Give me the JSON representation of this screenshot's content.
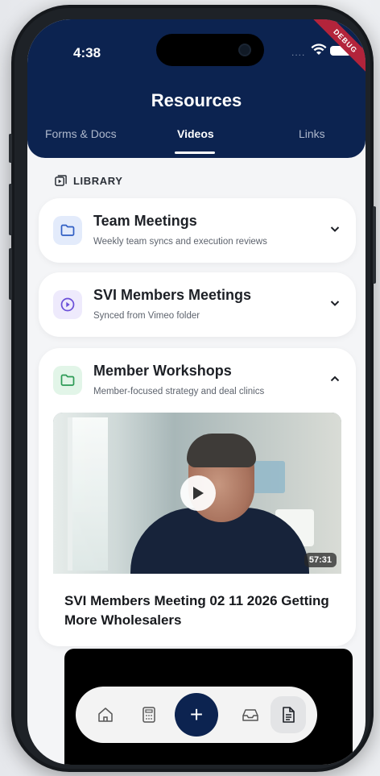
{
  "status_bar": {
    "time": "4:38",
    "signal": "....",
    "debug_banner": "DEBUG"
  },
  "header": {
    "title": "Resources",
    "tabs": [
      {
        "label": "Forms & Docs",
        "active": false
      },
      {
        "label": "Videos",
        "active": true
      },
      {
        "label": "Links",
        "active": false
      }
    ]
  },
  "library": {
    "label": "LIBRARY",
    "folders": [
      {
        "title": "Team Meetings",
        "subtitle": "Weekly team syncs and execution reviews",
        "icon": "folder-icon",
        "expanded": false
      },
      {
        "title": "SVI Members Meetings",
        "subtitle": "Synced from Vimeo folder",
        "icon": "play-circle-icon",
        "expanded": false
      },
      {
        "title": "Member Workshops",
        "subtitle": "Member-focused strategy and deal clinics",
        "icon": "folder-icon",
        "expanded": true
      }
    ],
    "videos": [
      {
        "title": "SVI Members Meeting 02 11 2026 Getting More Wholesalers",
        "duration": "57:31"
      }
    ]
  },
  "bottom_nav": {
    "items": [
      "home-icon",
      "calculator-icon",
      "add-icon",
      "inbox-icon",
      "document-icon"
    ],
    "active": "document-icon",
    "fab_label": "+"
  },
  "colors": {
    "brand": "#0c2350",
    "folder_blue": "#e3ebfb",
    "folder_purple": "#eeeafc",
    "folder_green": "#e2f5e8"
  }
}
